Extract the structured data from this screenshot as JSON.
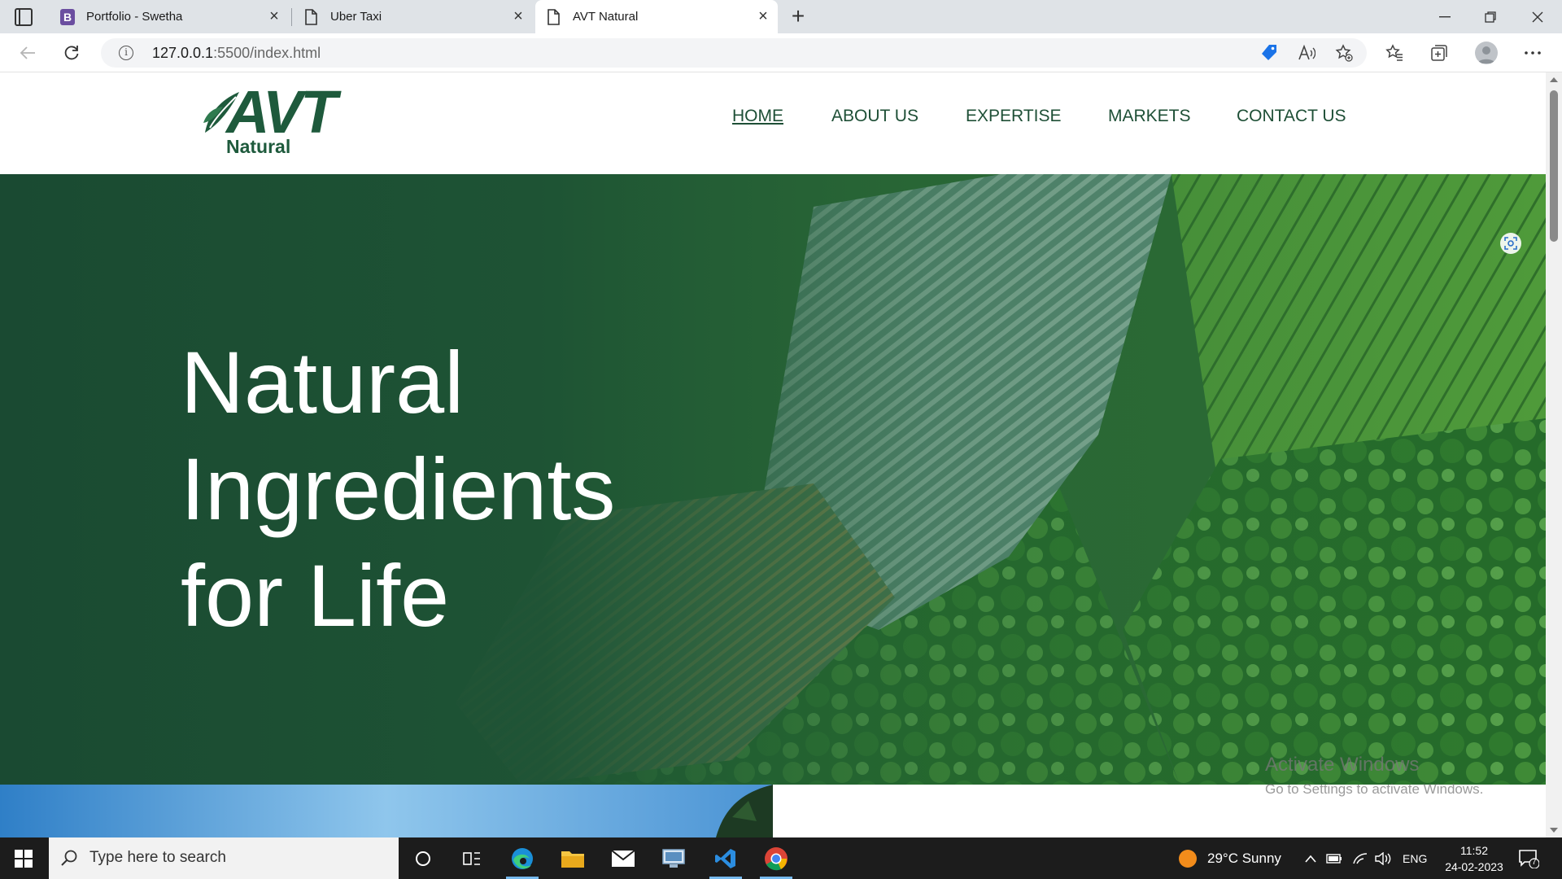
{
  "browser": {
    "tabs": [
      {
        "title": "Portfolio - Swetha",
        "favicon": "B",
        "active": false
      },
      {
        "title": "Uber Taxi",
        "active": false
      },
      {
        "title": "AVT Natural",
        "active": true
      }
    ],
    "url_host": "127.0.0.1",
    "url_rest": ":5500/index.html"
  },
  "site": {
    "logo_word": "AVT",
    "logo_sub": "Natural",
    "nav": [
      {
        "label": "HOME",
        "current": true
      },
      {
        "label": "ABOUT US",
        "current": false
      },
      {
        "label": "EXPERTISE",
        "current": false
      },
      {
        "label": "MARKETS",
        "current": false
      },
      {
        "label": "CONTACT US",
        "current": false
      }
    ],
    "hero_lines": [
      "Natural",
      "Ingredients",
      "for Life"
    ],
    "brand_color": "#1e5a3c"
  },
  "watermark": {
    "line1": "Activate Windows",
    "line2": "Go to Settings to activate Windows."
  },
  "taskbar": {
    "search_placeholder": "Type here to search",
    "weather": "29°C  Sunny",
    "language": "ENG",
    "time": "11:52",
    "date": "24-02-2023",
    "notifications": "7"
  }
}
